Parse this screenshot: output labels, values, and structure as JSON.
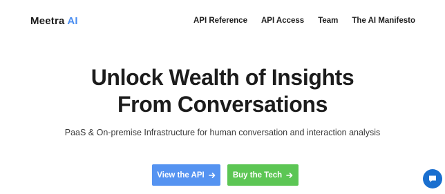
{
  "brand": {
    "name": "Meetra",
    "accent": "AI",
    "accent_color": "#4a8df0"
  },
  "nav": {
    "items": [
      {
        "label": "API Reference"
      },
      {
        "label": "API Access"
      },
      {
        "label": "Team"
      },
      {
        "label": "The AI Manifesto"
      }
    ]
  },
  "hero": {
    "title_line1": "Unlock Wealth of Insights",
    "title_line2": "From Conversations",
    "subtitle": "PaaS & On-premise Infrastructure for human conversation and interaction analysis"
  },
  "buttons": {
    "primary": {
      "label": "View the API",
      "color": "#5593f1",
      "icon": "arrow-right-icon"
    },
    "secondary": {
      "label": "Buy the Tech",
      "color": "#5cc654",
      "icon": "arrow-right-icon"
    }
  },
  "chat_widget": {
    "icon": "chat-icon",
    "color": "#1a6fcf"
  }
}
